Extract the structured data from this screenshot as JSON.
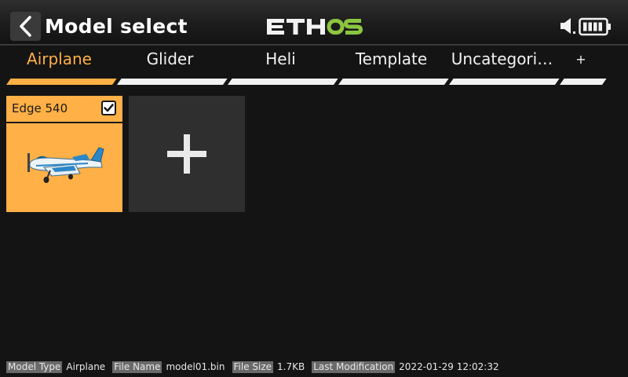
{
  "header": {
    "title": "Model select",
    "logo_text": "ETHOS",
    "back_icon": "chevron-left-icon",
    "sound_icon": "speaker-icon",
    "battery_icon": "battery-icon"
  },
  "tabs": [
    {
      "label": "Airplane",
      "active": true
    },
    {
      "label": "Glider",
      "active": false
    },
    {
      "label": "Heli",
      "active": false
    },
    {
      "label": "Template",
      "active": false
    },
    {
      "label": "Uncategori…",
      "active": false
    },
    {
      "label": "+",
      "active": false
    }
  ],
  "models": [
    {
      "name": "Edge 540",
      "selected": true,
      "image": "airplane-icon"
    }
  ],
  "add_tile_icon": "plus-icon",
  "status": {
    "model_type_label": "Model Type",
    "model_type_value": "Airplane",
    "file_name_label": "File Name",
    "file_name_value": "model01.bin",
    "file_size_label": "File Size",
    "file_size_value": "1.7KB",
    "last_mod_label": "Last Modification",
    "last_mod_value": "2022-01-29 12:02:32"
  },
  "colors": {
    "accent": "#ffb046",
    "logo_green": "#8cc63f",
    "background": "#141414"
  }
}
